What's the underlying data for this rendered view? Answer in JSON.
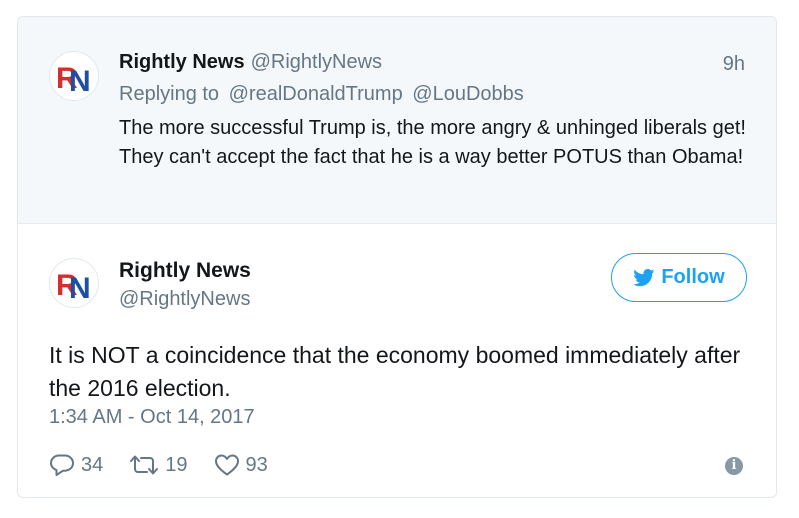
{
  "parent_tweet": {
    "logo_icon": "rightly-news-logo",
    "name": "Rightly News",
    "handle": "@RightlyNews",
    "time": "9h",
    "replying_to_label": "Replying to",
    "replying_to": [
      "@realDonaldTrump",
      "@LouDobbs"
    ],
    "text": "The more successful Trump is, the more angry & unhinged liberals get! They can't accept the fact that he is a way better POTUS than Obama!"
  },
  "main_tweet": {
    "logo_icon": "rightly-news-logo",
    "name": "Rightly News",
    "handle": "@RightlyNews",
    "follow_label": "Follow",
    "follow_icon": "twitter-bird-icon",
    "text": "It is NOT a coincidence that the economy boomed immediately after the 2016 election.",
    "timestamp": "1:34 AM - Oct 14, 2017",
    "actions": {
      "reply": {
        "icon": "reply-icon",
        "count": "34"
      },
      "retweet": {
        "icon": "retweet-icon",
        "count": "19"
      },
      "like": {
        "icon": "heart-icon",
        "count": "93"
      }
    },
    "info_icon": "info-icon"
  },
  "colors": {
    "accent": "#1da1f2",
    "muted_text": "#657786",
    "parent_background": "#f5f8fa",
    "logo_red": "#d62d2d",
    "logo_blue": "#1f4fa3"
  }
}
